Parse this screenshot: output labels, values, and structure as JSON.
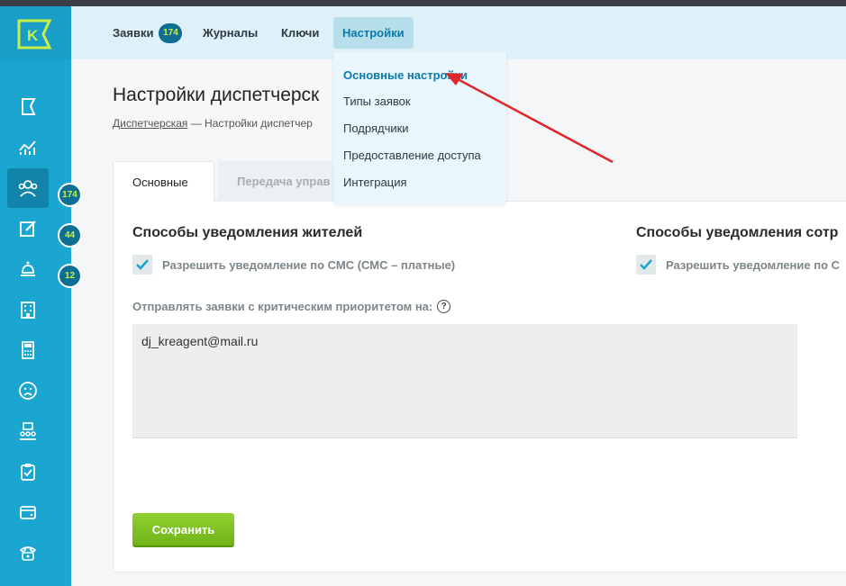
{
  "header": {
    "tabs": [
      {
        "label": "Заявки",
        "badge": "174"
      },
      {
        "label": "Журналы"
      },
      {
        "label": "Ключи"
      },
      {
        "label": "Настройки"
      }
    ]
  },
  "dropdown": {
    "items": [
      "Основные настройки",
      "Типы заявок",
      "Подрядчики",
      "Предоставление доступа",
      "Интеграция"
    ]
  },
  "sidebar": {
    "logo": "K",
    "badges": [
      "174",
      "44",
      "12"
    ]
  },
  "page": {
    "title": "Настройки диспетчерск",
    "breadcrumb_link": "Диспетчерская",
    "breadcrumb_rest": " — Настройки диспетчер"
  },
  "content_tabs": [
    "Основные",
    "Передача управ"
  ],
  "sections": {
    "residents_title": "Способы уведомления жителей",
    "residents_check": "Разрешить уведомление по СМС (СМС – платные)",
    "staff_title": "Способы уведомления сотр",
    "staff_check": "Разрешить уведомление по С"
  },
  "critical": {
    "label": "Отправлять заявки с критическим приоритетом на:",
    "help": "?",
    "value": "dj_kreagent@mail.ru"
  },
  "save_button": "Сохранить",
  "colors": {
    "sidebar": "#1aa6d1",
    "accent_green": "#7cc221",
    "badge_text": "#c9f04a",
    "arrow": "#e0262a"
  }
}
